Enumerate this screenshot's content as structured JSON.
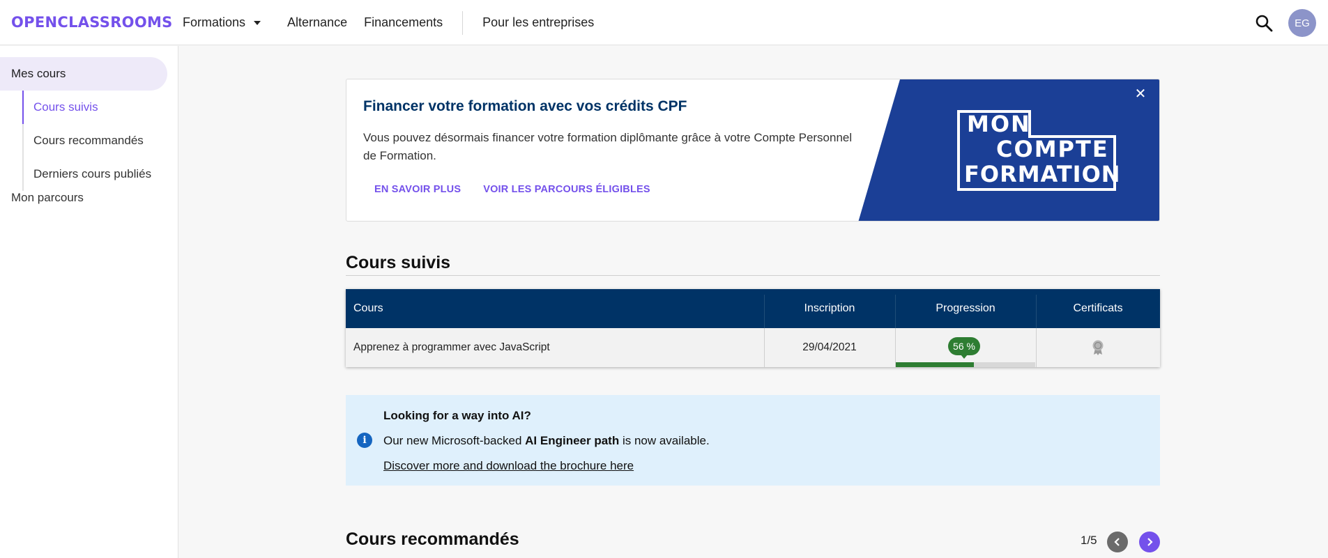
{
  "header": {
    "logo": "OPENCLASSROOMS",
    "nav": [
      {
        "label": "Formations",
        "has_dropdown": true
      },
      {
        "label": "Alternance"
      },
      {
        "label": "Financements"
      },
      {
        "label": "Pour les entreprises"
      }
    ],
    "avatar_initials": "EG"
  },
  "sidebar": {
    "top": "Mes cours",
    "items": [
      {
        "label": "Cours suivis",
        "active": true
      },
      {
        "label": "Cours recommandés"
      },
      {
        "label": "Derniers cours publiés"
      }
    ],
    "parcours": "Mon parcours"
  },
  "cpf_banner": {
    "title": "Financer votre formation avec vos crédits CPF",
    "text": "Vous pouvez désormais financer votre formation diplômante grâce à votre Compte Personnel de Formation.",
    "link1": "EN SAVOIR PLUS",
    "link2": "VOIR LES PARCOURS ÉLIGIBLES",
    "logo_lines": [
      "MON",
      "COMPTE",
      "FORMATION"
    ]
  },
  "cours_suivis": {
    "title": "Cours suivis",
    "columns": [
      "Cours",
      "Inscription",
      "Progression",
      "Certificats"
    ],
    "rows": [
      {
        "cours": "Apprenez à programmer avec JavaScript",
        "inscription": "29/04/2021",
        "progression_label": "56 %",
        "progression": 0.56
      }
    ]
  },
  "info_box": {
    "title": "Looking for a way into AI?",
    "text_prefix": "Our new Microsoft-backed ",
    "text_bold": "AI Engineer path",
    "text_suffix": " is now available.",
    "link": "Discover more and download the brochure here"
  },
  "cours_recommandes": {
    "title": "Cours recommandés",
    "pager": "1/5"
  },
  "colors": {
    "brand": "#7451eb",
    "header_table": "#003366",
    "cpf_blue": "#1b3f96",
    "progress": "#2e7d32",
    "info_bg": "#dff0fc"
  }
}
